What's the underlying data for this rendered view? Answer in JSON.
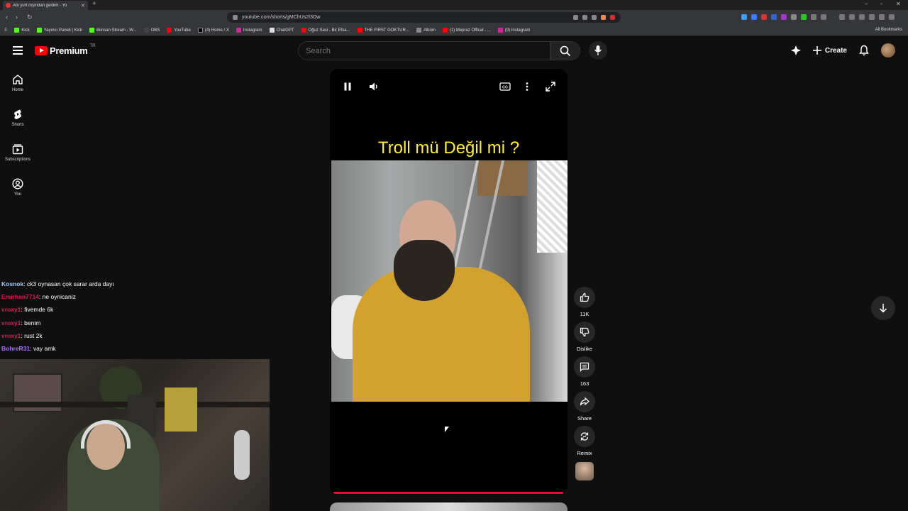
{
  "browser": {
    "tab_title": "Abi yurt dışından geldim - Yo",
    "new_tab": "+",
    "url": "youtube.com/shorts/gMChUs2I3Ow",
    "bookmarks": [
      "Kick",
      "Yayıncı Paneli | Kick",
      "ilkinsan Stream - W...",
      "OBS",
      "YouTube",
      "(4) Home / X",
      "Instagram",
      "ChatGPT",
      "Oğuz Sasi - Bir Efsa...",
      "THE FIRST GOKTUR...",
      "Albüm",
      "(1) Mepraz Offical - ...",
      "(9) Instagram"
    ],
    "all_bookmarks": "All Bookmarks"
  },
  "header": {
    "logo_text": "Premium",
    "country_code": "TR",
    "search_placeholder": "Search",
    "create_label": "Create"
  },
  "guide": [
    {
      "label": "Home",
      "icon": "home-icon"
    },
    {
      "label": "Shorts",
      "icon": "shorts-icon"
    },
    {
      "label": "Subscriptions",
      "icon": "subscriptions-icon"
    },
    {
      "label": "You",
      "icon": "you-icon"
    }
  ],
  "chat": [
    {
      "user": "Kosnok",
      "color": "#9ecbff",
      "message": ": ck3 oynasan çok sarar arda dayı"
    },
    {
      "user": "Emirhan7714",
      "color": "#e0174f",
      "message": ": ne oynicaniz"
    },
    {
      "user": "vroxy1",
      "color": "#e0174f",
      "message": ": fivemde 6k"
    },
    {
      "user": "vroxy1",
      "color": "#e0174f",
      "message": ": benim"
    },
    {
      "user": "vroxy1",
      "color": "#e0174f",
      "message": ": rust 2k"
    },
    {
      "user": "BohreR31",
      "color": "#a970ff",
      "message": ": vay amk"
    }
  ],
  "player": {
    "caption": "Troll mü Değil mi ?",
    "progress_percent": 100
  },
  "actions": {
    "like_count": "11K",
    "dislike_label": "Dislike",
    "comment_count": "163",
    "share_label": "Share",
    "remix_label": "Remix"
  },
  "colors": {
    "accent": "#ff0033",
    "caption_yellow": "#ffee33"
  }
}
